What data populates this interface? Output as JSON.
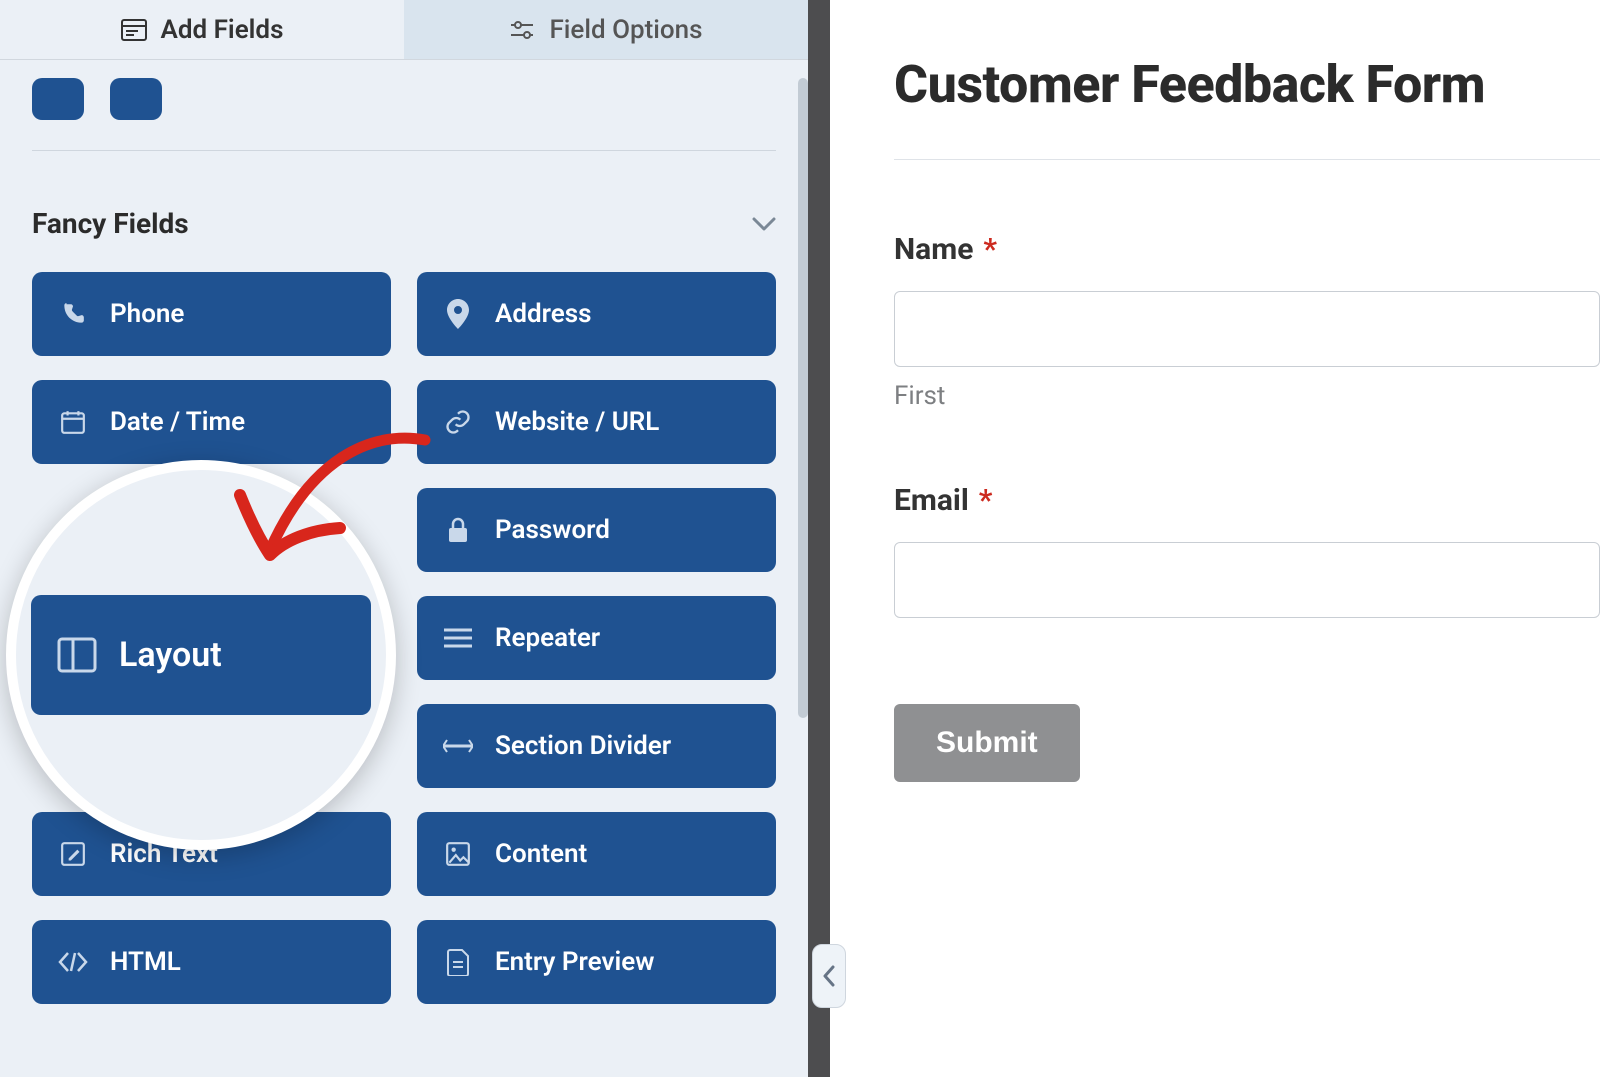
{
  "tabs": {
    "add_fields": "Add Fields",
    "field_options": "Field Options"
  },
  "section": {
    "title": "Fancy Fields"
  },
  "fields": {
    "phone": "Phone",
    "address": "Address",
    "date_time": "Date / Time",
    "website_url": "Website / URL",
    "password": "Password",
    "layout": "Layout",
    "repeater": "Repeater",
    "section_divider": "Section Divider",
    "rich_text": "Rich Text",
    "content": "Content",
    "html": "HTML",
    "entry_preview": "Entry Preview"
  },
  "form": {
    "title": "Customer Feedback Form",
    "name_label": "Name",
    "name_sublabel": "First",
    "email_label": "Email",
    "required_mark": "*",
    "submit_label": "Submit"
  },
  "icons": {
    "add_fields": "form-icon",
    "field_options": "sliders-icon",
    "chevron_down": "chevron-down-icon",
    "chevron_left": "chevron-left-icon"
  },
  "colors": {
    "field_button_bg": "#1f5291",
    "panel_bg": "#ebf0f6",
    "inactive_tab_bg": "#d9e4ee",
    "required": "#cc2a1f",
    "submit_bg": "#8f9092",
    "annotation_red": "#d8261c"
  }
}
